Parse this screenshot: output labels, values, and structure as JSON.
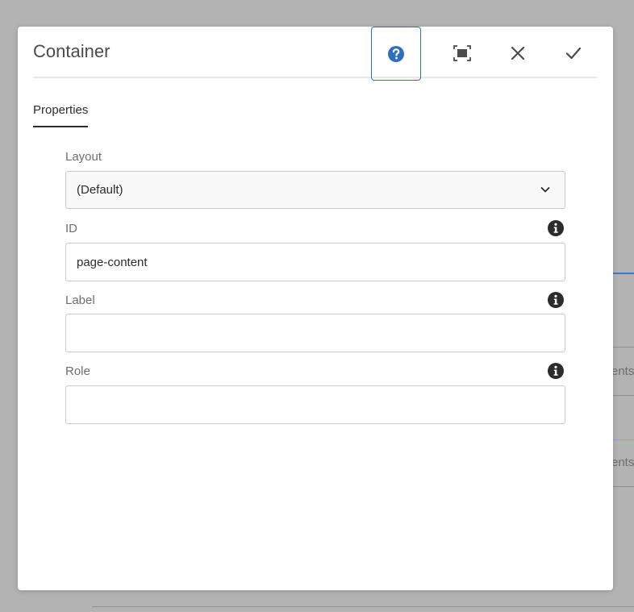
{
  "background": {
    "fragment_1": "ents",
    "fragment_2": "ents"
  },
  "dialog": {
    "title": "Container",
    "buttons": {
      "help": "question-circle-icon",
      "fullscreen": "fullscreen-icon",
      "close": "close-icon",
      "done": "checkmark-icon"
    },
    "tabs": [
      {
        "label": "Properties",
        "active": true
      }
    ],
    "fields": {
      "layout": {
        "label": "Layout",
        "value": "(Default)"
      },
      "id": {
        "label": "ID",
        "value": "page-content",
        "placeholder": ""
      },
      "label": {
        "label": "Label",
        "value": "",
        "placeholder": ""
      },
      "role": {
        "label": "Role",
        "value": "",
        "placeholder": ""
      }
    }
  },
  "colors": {
    "accent": "#2d6fc1",
    "overlay": "#b3b3b3"
  }
}
